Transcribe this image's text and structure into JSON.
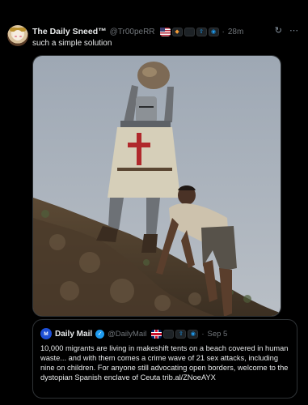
{
  "tweet": {
    "author_name": "The Daily Sneed™",
    "author_handle": "@Tr00peRR",
    "separator": "·",
    "time": "28m",
    "text": "such a simple solution",
    "top_icons": [
      "refresh-icon",
      "more-icon"
    ],
    "badges": [
      "us-flag-icon",
      "shield-icon",
      "apple-icon",
      "share-icon",
      "info-icon"
    ]
  },
  "media": {
    "description_icon": "image"
  },
  "quote": {
    "avatar_letters": "M",
    "author_name": "Daily Mail",
    "author_handle": "@DailyMail",
    "separator": "·",
    "date": "Sep 5",
    "badges": [
      "uk-flag-icon",
      "apple-icon",
      "share-icon",
      "info-icon"
    ],
    "text": "10,000 migrants are living in makeshift tents on a beach covered in human waste... and with them comes a crime wave of 21 sex attacks, including nine on children. For anyone still advocating open borders, welcome to the dystopian Spanish enclave of Ceuta trib.al/ZNoeAYX"
  },
  "colors": {
    "background": "#000000",
    "text": "#e7e9ea",
    "muted": "#71767b",
    "border": "#2f3336",
    "verified": "#1d9bf0"
  }
}
